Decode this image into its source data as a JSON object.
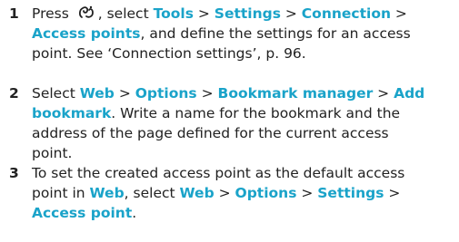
{
  "accent_color": "#1aa3c9",
  "icon": "menu-key-icon",
  "steps": [
    {
      "number": "1",
      "lines": [
        [
          {
            "t": "Press "
          },
          {
            "icon": "menu-key-icon"
          },
          {
            "t": ", select "
          },
          {
            "t": "Tools",
            "kw": true
          },
          {
            "t": " > "
          },
          {
            "t": "Settings",
            "kw": true
          },
          {
            "t": " > "
          },
          {
            "t": "Connection",
            "kw": true
          },
          {
            "t": " >"
          }
        ],
        [
          {
            "t": "Access points",
            "kw": true
          },
          {
            "t": ", and define the settings for an access"
          }
        ],
        [
          {
            "t": "point. See ‘Connection settings’, p. 96."
          }
        ]
      ]
    },
    {
      "number": "2",
      "lines": [
        [
          {
            "t": "Select "
          },
          {
            "t": "Web",
            "kw": true
          },
          {
            "t": " > "
          },
          {
            "t": "Options",
            "kw": true
          },
          {
            "t": " > "
          },
          {
            "t": "Bookmark manager",
            "kw": true
          },
          {
            "t": " > "
          },
          {
            "t": "Add",
            "kw": true
          }
        ],
        [
          {
            "t": "bookmark",
            "kw": true
          },
          {
            "t": ". Write a name for the bookmark and the"
          }
        ],
        [
          {
            "t": "address of the page defined for the current access"
          }
        ],
        [
          {
            "t": "point."
          }
        ]
      ]
    },
    {
      "number": "3",
      "lines": [
        [
          {
            "t": "To set the created access point as the default access"
          }
        ],
        [
          {
            "t": "point in "
          },
          {
            "t": "Web",
            "kw": true
          },
          {
            "t": ", select "
          },
          {
            "t": "Web",
            "kw": true
          },
          {
            "t": " > "
          },
          {
            "t": "Options",
            "kw": true
          },
          {
            "t": " > "
          },
          {
            "t": "Settings",
            "kw": true
          },
          {
            "t": " >"
          }
        ],
        [
          {
            "t": "Access point",
            "kw": true
          },
          {
            "t": "."
          }
        ]
      ]
    }
  ]
}
